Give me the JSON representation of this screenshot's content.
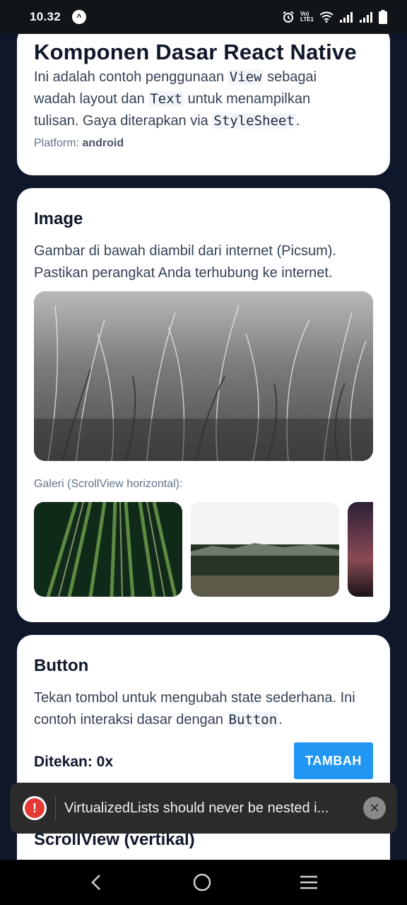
{
  "status_bar": {
    "time": "10.32",
    "brand_glyph": "^",
    "volte_line1": "Vo)",
    "volte_line2": "LTE1",
    "icons": [
      "alarm-icon",
      "volte-icon",
      "wifi-icon",
      "signal-icon",
      "signal-icon",
      "battery-icon"
    ]
  },
  "card_basics": {
    "title": "Komponen Dasar React Native",
    "text_1": "Ini adalah contoh penggunaan ",
    "code_1": "View",
    "text_2": " sebagai wadah layout dan ",
    "code_2": "Text",
    "text_3": " untuk menampilkan tulisan. Gaya diterapkan via ",
    "code_3": "StyleSheet",
    "text_4": ".",
    "platform_label": "Platform: ",
    "platform_value": "android"
  },
  "card_image": {
    "title": "Image",
    "description": "Gambar di bawah diambil dari internet (Picsum). Pastikan perangkat Anda terhubung ke internet.",
    "gallery_label": "Galeri (ScrollView horizontal):"
  },
  "card_button": {
    "title": "Button",
    "text_1": "Tekan tombol untuk mengubah state sederhana. Ini contoh interaksi dasar dengan ",
    "code_1": "Button",
    "text_2": ".",
    "counter_label": "Ditekan: 0x",
    "button_label": "TAMBAH"
  },
  "card_scrollview": {
    "title": "ScrollView (vertikal)"
  },
  "toast": {
    "message": "VirtualizedLists should never be nested i...",
    "icon": "error-icon",
    "dismiss_icon": "close-icon"
  },
  "nav_bar": {
    "icons": [
      "back-icon",
      "home-icon",
      "menu-icon"
    ]
  },
  "colors": {
    "background": "#0f172a",
    "card": "#ffffff",
    "button": "#2196f3",
    "toast": "#2b2b2b",
    "error": "#e53935"
  }
}
